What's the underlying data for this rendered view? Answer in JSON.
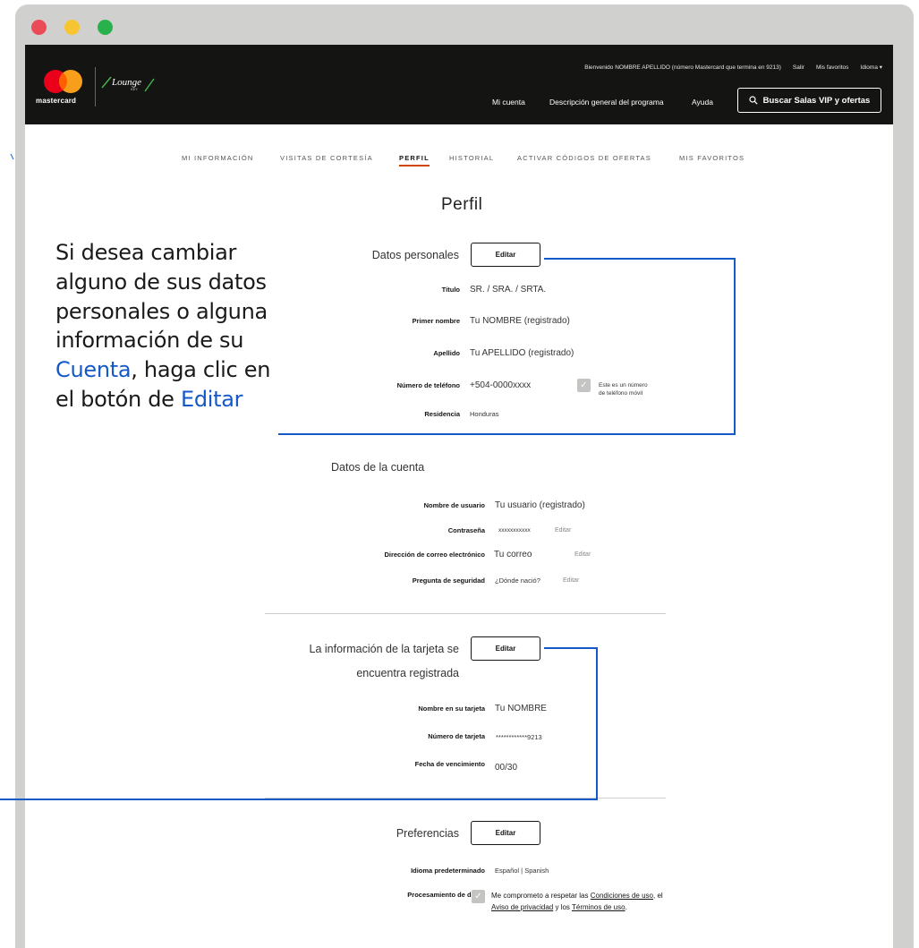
{
  "window": {
    "dots": [
      {
        "name": "close",
        "color": "#eb4a57"
      },
      {
        "name": "minimize",
        "color": "#f6c531"
      },
      {
        "name": "maximize",
        "color": "#29b24b"
      }
    ]
  },
  "header": {
    "brand_text": "mastercard",
    "lounge_text": "Lounge",
    "lounge_sub": "KEY",
    "welcome": "Bienvenido NOMBRE APELLIDO (número Mastercard que termina en 9213)",
    "salir": "Salir",
    "mis_favoritos": "Mis favoritos",
    "idioma": "Idioma ▾",
    "nav": [
      "Mi cuenta",
      "Descripción general del programa",
      "Ayuda"
    ],
    "search_label": "Buscar Salas VIP y ofertas",
    "search_icon": "search-icon"
  },
  "tabs": [
    "MI INFORMACIÓN",
    "VISITAS DE CORTESÍA",
    "PERFIL",
    "HISTORIAL",
    "ACTIVAR CÓDIGOS DE OFERTAS",
    "MIS FAVORITOS"
  ],
  "active_tab": "PERFIL",
  "page_title": "Perfil",
  "personal": {
    "title": "Datos personales",
    "edit": "Editar",
    "rows": [
      {
        "label": "Título",
        "value": "SR. / SRA. / SRTA."
      },
      {
        "label": "Primer nombre",
        "value": "Tu NOMBRE (registrado)"
      },
      {
        "label": "Apellido",
        "value": "Tu APELLIDO (registrado)"
      },
      {
        "label": "Número de teléfono",
        "value": "+504-0000xxxx"
      },
      {
        "label": "Residencia",
        "value": "Honduras"
      }
    ],
    "mobile_check_label": "Este es un número de teléfono móvil",
    "mobile_check_line1": "Este es un número",
    "mobile_check_line2": "de teléfono móvil"
  },
  "account": {
    "title": "Datos de la cuenta",
    "rows": [
      {
        "label": "Nombre de usuario",
        "value": "Tu usuario (registrado)"
      },
      {
        "label": "Contraseña",
        "value": "xxxxxxxxxxx",
        "edit": "Editar"
      },
      {
        "label": "Dirección de correo electrónico",
        "value": "Tu correo",
        "edit": "Editar"
      },
      {
        "label": "Pregunta de seguridad",
        "value": "¿Dónde nació?",
        "edit": "Editar"
      }
    ]
  },
  "card": {
    "title_line1": "La información de la tarjeta se",
    "title_line2": "encuentra registrada",
    "edit": "Editar",
    "rows": [
      {
        "label": "Nombre en su tarjeta",
        "value": "Tu NOMBRE"
      },
      {
        "label": "Número de tarjeta",
        "value": "************9213"
      },
      {
        "label": "Fecha de vencimiento",
        "value": "00/30"
      }
    ]
  },
  "preferences": {
    "title": "Preferencias",
    "edit": "Editar",
    "language_label": "Idioma predeterminado",
    "language_value": "Español | Spanish",
    "data_label": "Procesamiento de datos",
    "data_text_1": "Me comprometo a respetar las ",
    "data_link_1": "Condiciones de uso",
    "data_text_2": ", el ",
    "data_link_2": "Aviso de privacidad",
    "data_text_3": " y los ",
    "data_link_3": "Términos de uso",
    "data_text_4": "."
  },
  "callout": {
    "line1": "Si desea cambiar",
    "line2": "alguno de sus datos",
    "line3": "personales o alguna",
    "line4": "información de su",
    "line5_blue": "Cuenta",
    "line5_rest": ", haga clic en",
    "line6_prefix": "el botón de ",
    "line6_blue": "Editar"
  },
  "colors": {
    "accent": "#cf4500",
    "callout_blue": "#1559c7",
    "header_bg": "#141413"
  }
}
